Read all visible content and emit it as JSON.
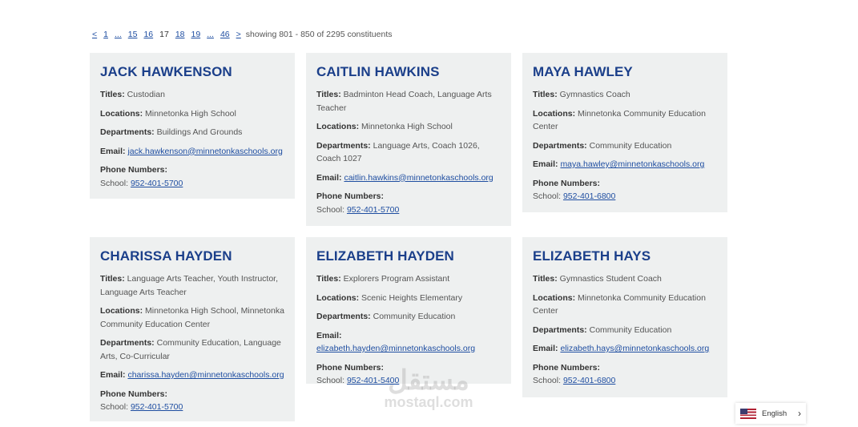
{
  "pagination": {
    "prev": "<",
    "first": "1",
    "ellipsis_left": "...",
    "pages": [
      "15",
      "16"
    ],
    "current": "17",
    "pages_after": [
      "18",
      "19"
    ],
    "ellipsis_right": "...",
    "last": "46",
    "next": ">",
    "showing": "showing 801 - 850 of 2295 constituents"
  },
  "labels": {
    "titles": "Titles:",
    "locations": "Locations:",
    "departments": "Departments:",
    "email": "Email:",
    "phone_numbers": "Phone Numbers:",
    "school": "School:"
  },
  "cards": [
    {
      "name": "JACK HAWKENSON",
      "titles": "Custodian",
      "locations": "Minnetonka High School",
      "departments": "Buildings And Grounds",
      "email": "jack.hawkenson@minnetonkaschools.org",
      "phone": "952-401-5700"
    },
    {
      "name": "CAITLIN HAWKINS",
      "titles": "Badminton Head Coach, Language Arts Teacher",
      "locations": "Minnetonka High School",
      "departments": "Language Arts, Coach 1026, Coach 1027",
      "email": "caitlin.hawkins@minnetonkaschools.org",
      "phone": "952-401-5700"
    },
    {
      "name": "MAYA HAWLEY",
      "titles": "Gymnastics Coach",
      "locations": "Minnetonka Community Education Center",
      "departments": "Community Education",
      "email": "maya.hawley@minnetonkaschools.org",
      "phone": "952-401-6800"
    },
    {
      "name": "CHARISSA HAYDEN",
      "titles": "Language Arts Teacher, Youth Instructor, Language Arts Teacher",
      "locations": "Minnetonka High School, Minnetonka Community Education Center",
      "departments": "Community Education, Language Arts, Co-Curricular",
      "email": "charissa.hayden@minnetonkaschools.org",
      "phone": "952-401-5700"
    },
    {
      "name": "ELIZABETH HAYDEN",
      "titles": "Explorers Program Assistant",
      "locations": "Scenic Heights Elementary",
      "departments": "Community Education",
      "email": "elizabeth.hayden@minnetonkaschools.org",
      "phone": "952-401-5400"
    },
    {
      "name": "ELIZABETH HAYS",
      "titles": "Gymnastics Student Coach",
      "locations": "Minnetonka Community Education Center",
      "departments": "Community Education",
      "email": "elizabeth.hays@minnetonkaschools.org",
      "phone": "952-401-6800"
    }
  ],
  "watermark": {
    "arabic": "مستقل",
    "latin": "mostaql.com"
  },
  "language": {
    "label": "English",
    "flag": "us-flag-icon",
    "chevron": "›"
  },
  "colors": {
    "name": "#1b3f8a",
    "link": "#1f4ea1",
    "card_bg": "#eef0f0"
  }
}
